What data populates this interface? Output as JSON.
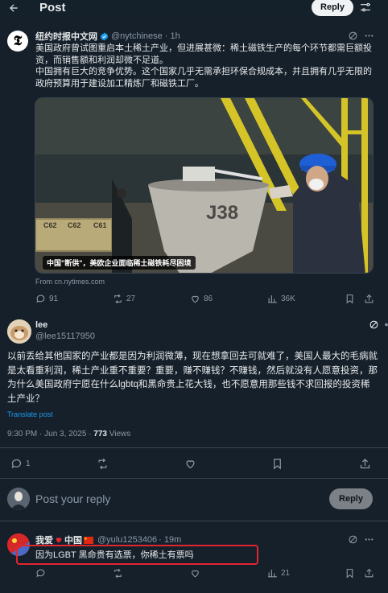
{
  "header": {
    "title": "Post",
    "reply_button": "Reply"
  },
  "quoted_post": {
    "avatar_letter": "𝕿",
    "name": "纽约时报中文网",
    "handle": "@nytchinese",
    "time": "· 1h",
    "text": "美国政府曾试图重启本土稀土产业，但进展甚微：稀土磁铁生产的每个环节都需巨额投资，而销售额和利润却微不足道。\n中国拥有巨大的竞争优势。这个国家几乎无需承担环保合规成本，并且拥有几乎无限的政府预算用于建设加工精炼厂和磁铁工厂。",
    "media_caption": "中国\"断供\"，美欧企业面临稀土磁铁耗尽困境",
    "tank_label": "J38",
    "crate_labels": [
      "C62",
      "C62",
      "C61"
    ],
    "from_link": "From cn.nytimes.com",
    "actions": {
      "replies": "91",
      "reposts": "27",
      "likes": "86",
      "views": "36K"
    }
  },
  "main_post": {
    "name": "lee",
    "handle": "@lee15117950",
    "text": "以前丢给其他国家的产业都是因为利润微薄，现在想拿回去可就难了，美国人最大的毛病就是太看重利润，稀土产业重不重要？重要，赚不赚钱？不赚钱，然后就没有人愿意投资，那为什么美国政府宁愿在什么lgbtq和黑命贵上花大钱，也不愿意用那些钱不求回报的投资稀土产业？",
    "translate_label": "Translate post",
    "timestamp": "9:30 PM · Jun 3, 2025 · ",
    "views_count": "773",
    "views_label": " Views",
    "actions": {
      "replies": "1"
    }
  },
  "composer": {
    "placeholder": "Post your reply",
    "button": "Reply"
  },
  "reply_post": {
    "name_prefix": "我爱",
    "name_mid": "中国",
    "handle": "@yulu1253406",
    "time": "· 19m",
    "text": "因为LGBT 黑命贵有选票，你稀土有票吗",
    "actions": {
      "likes": "21"
    }
  },
  "colors": {
    "background": "#15202b",
    "accent": "#1d9bf0",
    "muted": "#8b98a5",
    "highlight": "#e0262f"
  }
}
